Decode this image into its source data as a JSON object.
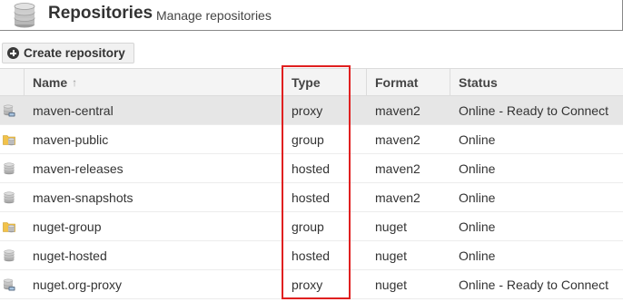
{
  "header": {
    "title": "Repositories",
    "subtitle": "Manage repositories",
    "icon": "database-icon"
  },
  "toolbar": {
    "create_label": "Create repository",
    "create_icon": "plus-circle-icon"
  },
  "table": {
    "columns": [
      {
        "key": "name",
        "label": "Name",
        "sort_icon": "sort-up-arrow-icon",
        "sort_glyph": "↑"
      },
      {
        "key": "type",
        "label": "Type"
      },
      {
        "key": "format",
        "label": "Format"
      },
      {
        "key": "status",
        "label": "Status"
      }
    ],
    "rows": [
      {
        "icon": "proxy-repository-icon",
        "name": "maven-central",
        "type": "proxy",
        "format": "maven2",
        "status": "Online - Ready to Connect",
        "selected": true
      },
      {
        "icon": "group-repository-icon",
        "name": "maven-public",
        "type": "group",
        "format": "maven2",
        "status": "Online"
      },
      {
        "icon": "hosted-repository-icon",
        "name": "maven-releases",
        "type": "hosted",
        "format": "maven2",
        "status": "Online"
      },
      {
        "icon": "hosted-repository-icon",
        "name": "maven-snapshots",
        "type": "hosted",
        "format": "maven2",
        "status": "Online"
      },
      {
        "icon": "group-repository-icon",
        "name": "nuget-group",
        "type": "group",
        "format": "nuget",
        "status": "Online"
      },
      {
        "icon": "hosted-repository-icon",
        "name": "nuget-hosted",
        "type": "hosted",
        "format": "nuget",
        "status": "Online"
      },
      {
        "icon": "proxy-repository-icon",
        "name": "nuget.org-proxy",
        "type": "proxy",
        "format": "nuget",
        "status": "Online - Ready to Connect"
      }
    ]
  },
  "colors": {
    "highlight_border": "#e02020",
    "selected_row": "#e6e6e6",
    "header_bg": "#f4f4f4"
  }
}
